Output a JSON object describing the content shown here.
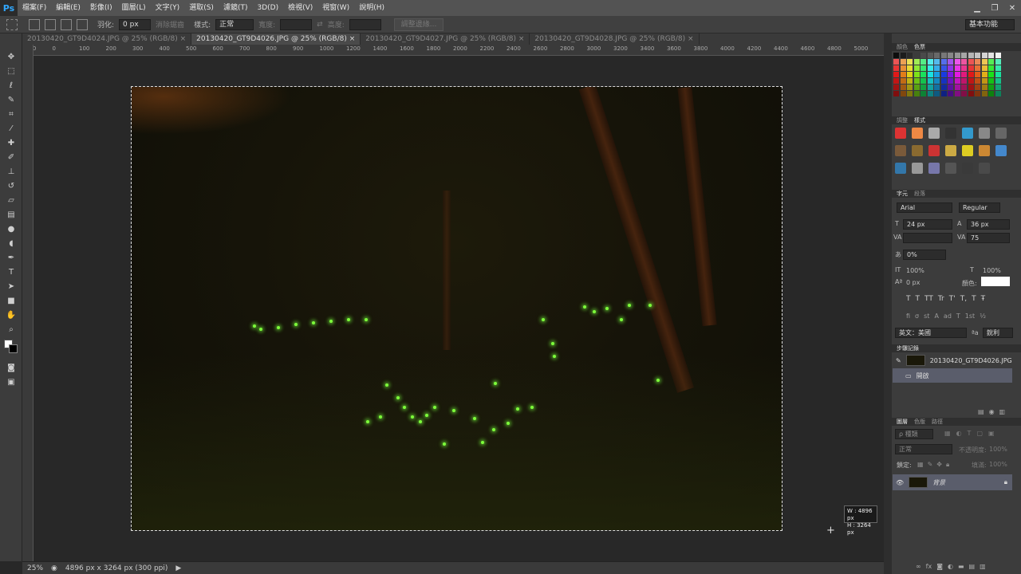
{
  "app": {
    "logo": "Ps"
  },
  "menu": [
    "檔案(F)",
    "編輯(E)",
    "影像(I)",
    "圖層(L)",
    "文字(Y)",
    "選取(S)",
    "濾鏡(T)",
    "3D(D)",
    "檢視(V)",
    "視窗(W)",
    "說明(H)"
  ],
  "window_controls": {
    "minimize": "▁",
    "restore": "❐",
    "close": "✕"
  },
  "options": {
    "feather_label": "羽化:",
    "feather_value": "0 px",
    "antialias_label": "消除鋸齒",
    "style_label": "樣式:",
    "style_value": "正常",
    "width_label": "寬度:",
    "height_label": "高度:",
    "refine_edge": "調整邊緣...",
    "workspace": "基本功能"
  },
  "tabs": [
    {
      "label": "20130420_GT9D4024.JPG @ 25% (RGB/8)",
      "close": "×"
    },
    {
      "label": "20130420_GT9D4026.JPG @ 25% (RGB/8)",
      "close": "×"
    },
    {
      "label": "20130420_GT9D4027.JPG @ 25% (RGB/8)",
      "close": "×"
    },
    {
      "label": "20130420_GT9D4028.JPG @ 25% (RGB/8)",
      "close": "×"
    }
  ],
  "ruler_ticks": [
    "100",
    "0",
    "100",
    "200",
    "300",
    "400",
    "500",
    "600",
    "700",
    "800",
    "900",
    "1000",
    "1200",
    "1400",
    "1600",
    "1800",
    "2000",
    "2200",
    "2400",
    "2600",
    "2800",
    "3000",
    "3200",
    "3400",
    "3600",
    "3800",
    "4000",
    "4200",
    "4400",
    "4600",
    "4800",
    "5000"
  ],
  "tools": [
    "move-tool",
    "marquee-tool",
    "lasso-tool",
    "quick-select-tool",
    "crop-tool",
    "eyedropper-tool",
    "healing-tool",
    "brush-tool",
    "stamp-tool",
    "history-brush-tool",
    "eraser-tool",
    "gradient-tool",
    "blur-tool",
    "dodge-tool",
    "pen-tool",
    "type-tool",
    "path-select-tool",
    "shape-tool",
    "hand-tool",
    "zoom-tool"
  ],
  "size_tip": {
    "w": "W : 4896 px",
    "h": "H : 3264 px"
  },
  "status": {
    "zoom": "25%",
    "doc_size": "4896 px x 3264 px (300 ppi)"
  },
  "swatches_panel": {
    "tabs": [
      "顏色",
      "色票"
    ]
  },
  "styles_panel": {
    "tabs": [
      "調整",
      "樣式"
    ]
  },
  "character_panel": {
    "tabs": [
      "字元",
      "段落"
    ],
    "font": "Arial",
    "weight": "Regular",
    "size": "24 px",
    "leading": "36 px",
    "kerning": "",
    "tracking": "75",
    "tsume": "0%",
    "vscale": "100%",
    "hscale": "100%",
    "baseline": "0 px",
    "color_label": "顏色:",
    "text_styles": [
      "T",
      "T",
      "TT",
      "Tr",
      "T'",
      "T,",
      "T",
      "Ŧ"
    ],
    "opentype": [
      "fi",
      "σ",
      "st",
      "A",
      "ad",
      "T",
      "1st",
      "½"
    ],
    "language": "英文：美國",
    "aa_icon": "ªa",
    "aa_method": "銳利",
    "color": "#ffffff"
  },
  "history_panel": {
    "tabs": [
      "步驟記錄"
    ],
    "snapshot": "20130420_GT9D4026.JPG",
    "step": "開啟"
  },
  "layers_panel": {
    "tabs": [
      "圖層",
      "色版",
      "路徑"
    ],
    "kind_label": "ρ 種類",
    "blend_mode": "正常",
    "opacity_label": "不透明度:",
    "opacity": "100%",
    "lock_label": "鎖定:",
    "fill_label": "填滿:",
    "fill": "100%",
    "layer_name": "背景"
  }
}
